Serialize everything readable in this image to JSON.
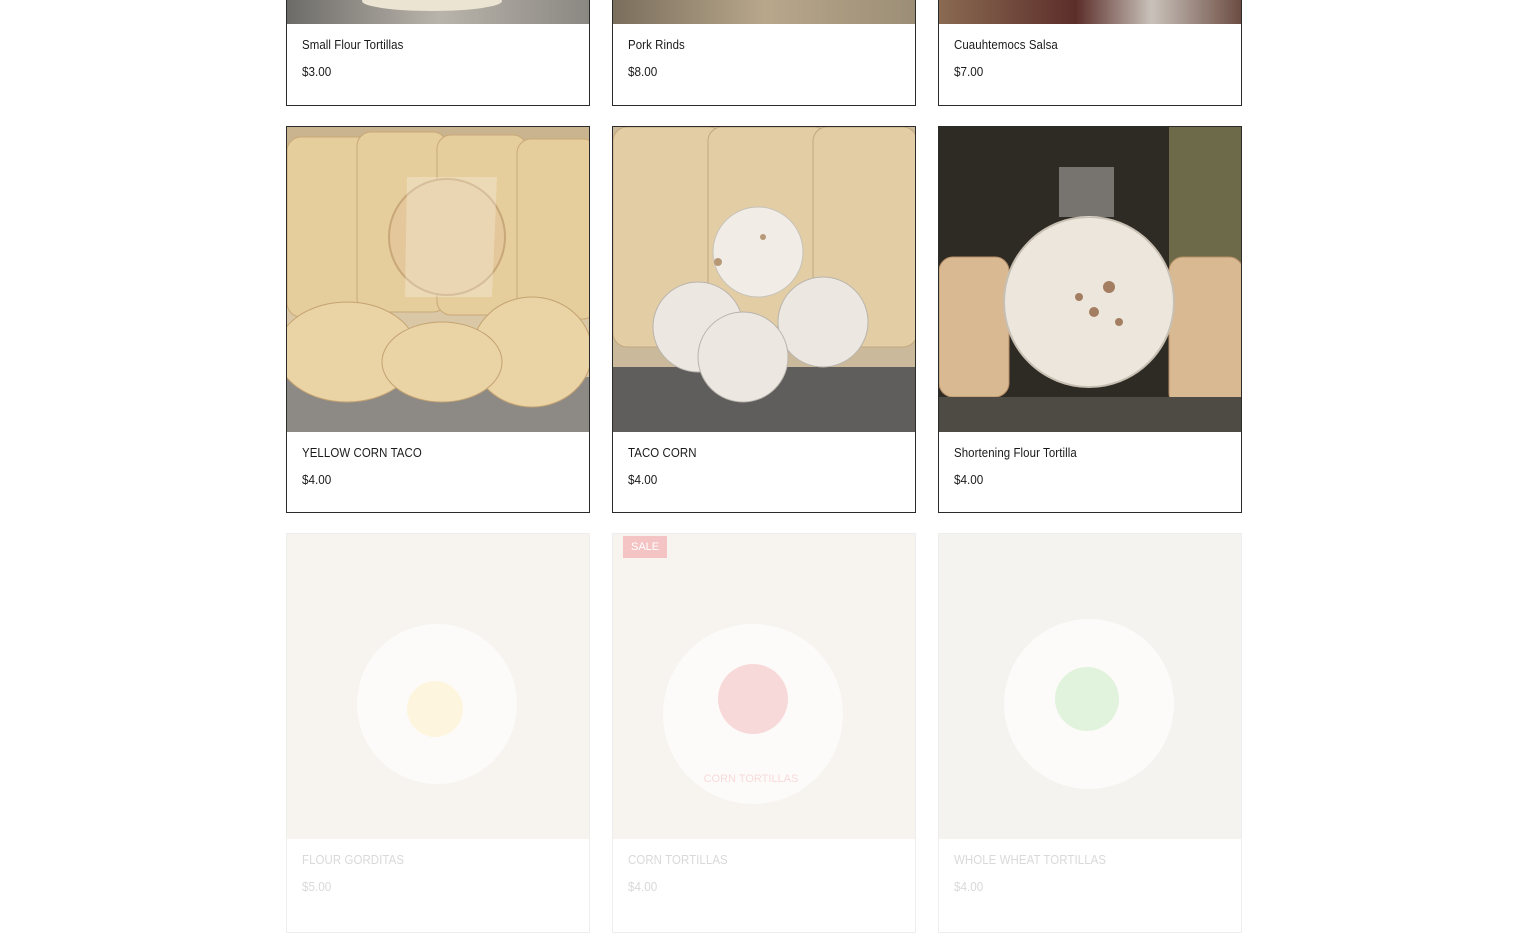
{
  "products": [
    {
      "name": "Small Flour Tortillas",
      "price": "$3.00"
    },
    {
      "name": "Pork Rinds",
      "price": "$8.00"
    },
    {
      "name": "Cuauhtemocs Salsa",
      "price": "$7.00"
    },
    {
      "name": "YELLOW CORN TACO",
      "price": "$4.00"
    },
    {
      "name": "TACO CORN",
      "price": "$4.00"
    },
    {
      "name": "Shortening Flour Tortilla",
      "price": "$4.00"
    },
    {
      "name": "FLOUR GORDITAS",
      "price": "$5.00"
    },
    {
      "name": "CORN TORTILLAS",
      "price": "$4.00",
      "badge": "SALE"
    },
    {
      "name": "WHOLE WHEAT TORTILLAS",
      "price": "$4.00"
    }
  ],
  "package_labels": {
    "corn": "CORN TORTILLAS"
  },
  "colors": {
    "border": "#2b2b2b",
    "sale_badge": "#f4c3c3",
    "tortilla": "#e9cf9e",
    "steel": "#5a5a5a"
  }
}
